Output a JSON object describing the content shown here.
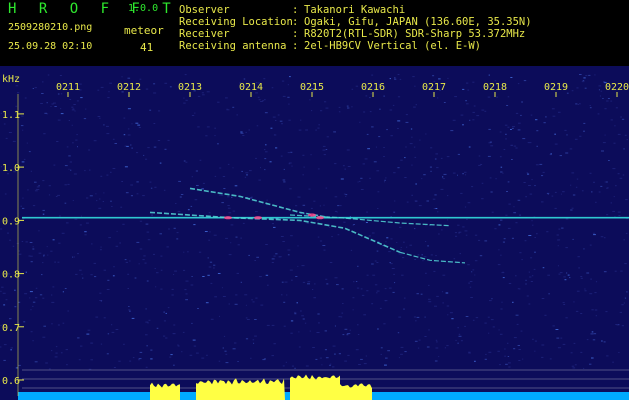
{
  "header": {
    "app_title": "H R O F F T",
    "app_version": "1.0.0",
    "file_name": "2509280210.png",
    "timestamp": "25.09.28 02:10",
    "meteor_label": "meteor",
    "meteor_count": "41"
  },
  "info": {
    "rows": [
      {
        "key": "Observer",
        "sep": ":",
        "value": "Takanori Kawachi"
      },
      {
        "key": "Receiving Location",
        "sep": ":",
        "value": "Ogaki, Gifu, JAPAN (136.60E, 35.35N)"
      },
      {
        "key": "Receiver",
        "sep": ":",
        "value": "R820T2(RTL-SDR) SDR-Sharp 53.372MHz"
      },
      {
        "key": "Receiving antenna",
        "sep": ":",
        "value": "2el-HB9CV Vertical (el. E-W)"
      }
    ]
  },
  "chart_data": {
    "type": "heatmap",
    "ylabel": "kHz",
    "xticks": [
      "0211",
      "0212",
      "0213",
      "0214",
      "0215",
      "0216",
      "0217",
      "0218",
      "0219",
      "0220"
    ],
    "yticks": [
      "1.1",
      "1.0",
      "0.9",
      "0.8",
      "0.7",
      "0.6"
    ],
    "ylim": [
      0.57,
      1.19
    ],
    "colors": {
      "background": "#0c0c5a",
      "carrier": "#33dddd",
      "echo": "#55d8d8",
      "echo_hot": "#ff4488",
      "bands": "#ffff44",
      "floor": "#00aaff",
      "tick_text": "#e8e84a",
      "ref_line": "#ffffff"
    }
  }
}
